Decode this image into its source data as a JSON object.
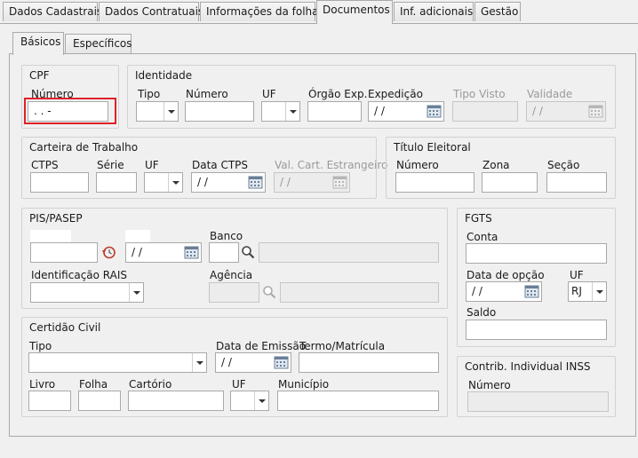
{
  "tabs": [
    "Dados Cadastrais",
    "Dados Contratuais",
    "Informações da folha",
    "Documentos",
    "Inf. adicionais",
    "Gestão"
  ],
  "subtabs": [
    "Básicos",
    "Específicos"
  ],
  "cpf": {
    "title": "CPF",
    "numero_label": "Número",
    "numero_value": "  .  .  -"
  },
  "identidade": {
    "title": "Identidade",
    "tipo": "Tipo",
    "numero": "Número",
    "uf": "UF",
    "orgao": "Órgão Exp.",
    "expedicao": "Expedição",
    "expedicao_value": "/ /",
    "tipo_visto": "Tipo Visto",
    "validade": "Validade",
    "validade_value": "/ /"
  },
  "ctps": {
    "title": "Carteira de Trabalho",
    "ctps": "CTPS",
    "serie": "Série",
    "uf": "UF",
    "data": "Data CTPS",
    "data_value": "/ /",
    "val": "Val. Cart. Estrangeiro",
    "val_value": "/ /"
  },
  "titulo": {
    "title": "Título Eleitoral",
    "numero": "Número",
    "zona": "Zona",
    "secao": "Seção"
  },
  "pis": {
    "title": "PIS/PASEP",
    "date_value": "/ /",
    "banco": "Banco",
    "rais": "Identificação RAIS",
    "agencia": "Agência"
  },
  "fgts": {
    "title": "FGTS",
    "conta": "Conta",
    "data_opcao": "Data de opção",
    "data_value": "/ /",
    "uf": "UF",
    "uf_value": "RJ",
    "saldo": "Saldo"
  },
  "certidao": {
    "title": "Certidão Civil",
    "tipo": "Tipo",
    "data_emissao": "Data de Emissão",
    "data_value": "/ /",
    "termo": "Termo/Matrícula",
    "livro": "Livro",
    "folha": "Folha",
    "cartorio": "Cartório",
    "uf": "UF",
    "municipio": "Município"
  },
  "inss": {
    "title": "Contrib. Individual INSS",
    "numero": "Número"
  },
  "icons": {
    "calendar": "calendar-icon",
    "search": "magnifier-icon",
    "history": "history-icon",
    "dropdown": "chevron-down-icon"
  },
  "colors": {
    "highlight_border": "#e0202a"
  }
}
